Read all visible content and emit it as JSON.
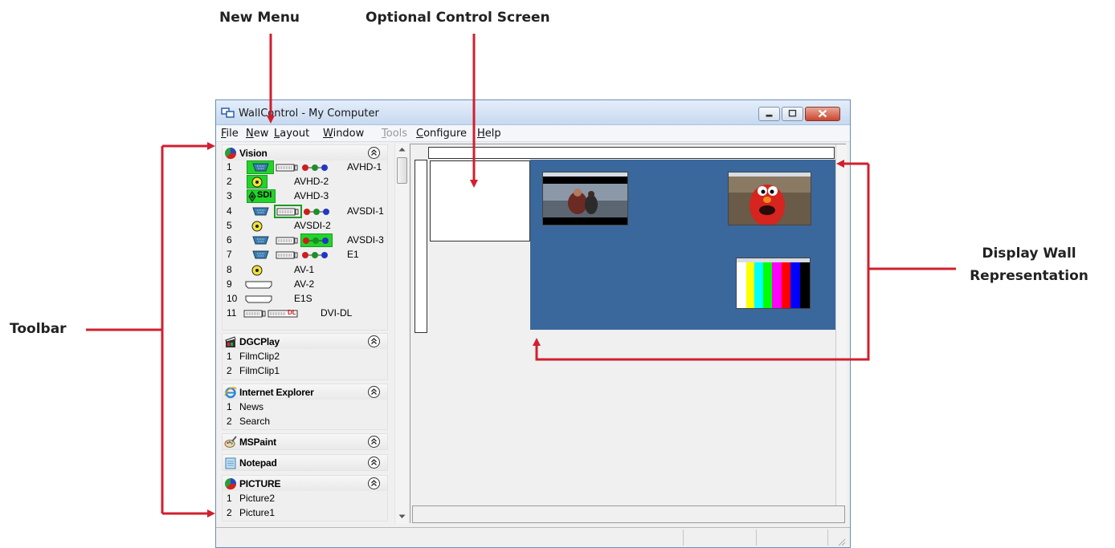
{
  "annotations": {
    "new_menu": "New Menu",
    "optional_control_screen": "Optional Control Screen",
    "display_wall_line1": "Display Wall",
    "display_wall_line2": "Representation",
    "toolbar": "Toolbar",
    "arrow_color": "#d0202e"
  },
  "window": {
    "title": "WallControl - My Computer"
  },
  "menu": [
    {
      "key": "F",
      "rest": "ile"
    },
    {
      "key": "N",
      "rest": "ew"
    },
    {
      "key": "L",
      "rest": "ayout"
    },
    {
      "key": "W",
      "rest": "indow"
    },
    {
      "key": "T",
      "rest": "ools"
    },
    {
      "key": "C",
      "rest": "onfigure"
    },
    {
      "key": "H",
      "rest": "elp"
    }
  ],
  "groups": {
    "vision": {
      "title": "Vision",
      "items": [
        {
          "num": "1",
          "label": "AVHD-1"
        },
        {
          "num": "2",
          "label": "AVHD-2"
        },
        {
          "num": "3",
          "label": "AVHD-3",
          "badge": "SDI"
        },
        {
          "num": "4",
          "label": "AVSDI-1"
        },
        {
          "num": "5",
          "label": "AVSDI-2"
        },
        {
          "num": "6",
          "label": "AVSDI-3"
        },
        {
          "num": "7",
          "label": "E1"
        },
        {
          "num": "8",
          "label": "AV-1"
        },
        {
          "num": "9",
          "label": "AV-2"
        },
        {
          "num": "10",
          "label": "E1S"
        },
        {
          "num": "11",
          "label": "DVI-DL",
          "badge": "DL"
        }
      ]
    },
    "dgcplay": {
      "title": "DGCPlay",
      "items": [
        {
          "num": "1",
          "label": "FilmClip2"
        },
        {
          "num": "2",
          "label": "FilmClip1"
        }
      ]
    },
    "ie": {
      "title": "Internet Explorer",
      "items": [
        {
          "num": "1",
          "label": "News"
        },
        {
          "num": "2",
          "label": "Search"
        }
      ]
    },
    "mspaint": {
      "title": "MSPaint"
    },
    "notepad": {
      "title": "Notepad"
    },
    "picture": {
      "title": "PICTURE",
      "items": [
        {
          "num": "1",
          "label": "Picture2"
        },
        {
          "num": "2",
          "label": "Picture1"
        }
      ]
    }
  },
  "colors": {
    "wall": "#3a689c",
    "active_source": "#22d42a",
    "red": "#cc1e1e",
    "green": "#1c8f2a",
    "blue": "#2336c2",
    "annotation": "#d0202e"
  },
  "icons": [
    "app-icon",
    "vision-icon",
    "clapperboard-icon",
    "ie-icon",
    "mspaint-icon",
    "notepad-icon",
    "picture-icon",
    "collapse-icon",
    "vga-connector-icon",
    "dvi-connector-icon",
    "rca-connector-icon",
    "rgb-dots-icon",
    "hdmi-connector-icon"
  ]
}
